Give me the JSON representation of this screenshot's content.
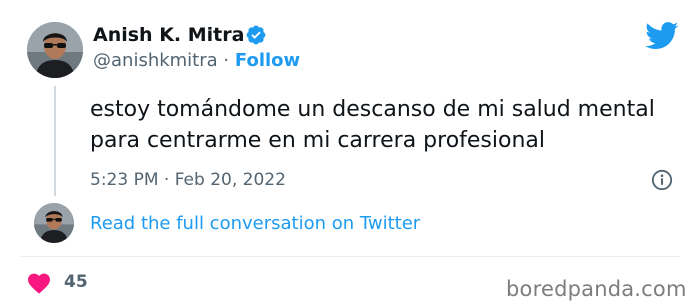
{
  "tweet": {
    "author": {
      "name": "Anish K. Mitra",
      "handle": "@anishkmitra",
      "verified": true
    },
    "separator": "·",
    "follow_label": "Follow",
    "text": "estoy tomándome un descanso de mi salud mental para centrarme en mi carrera profesional",
    "timestamp": "5:23 PM · Feb 20, 2022",
    "read_conversation_label": "Read the full conversation on Twitter",
    "likes": "45"
  },
  "watermark": "boredpanda.com",
  "colors": {
    "link_blue": "#1d9bf0",
    "heart_red": "#f91880",
    "muted_text": "#536471"
  },
  "icons": {
    "verified": "verified-badge-icon",
    "brand": "twitter-bird-icon",
    "info": "info-icon",
    "like": "heart-icon"
  }
}
